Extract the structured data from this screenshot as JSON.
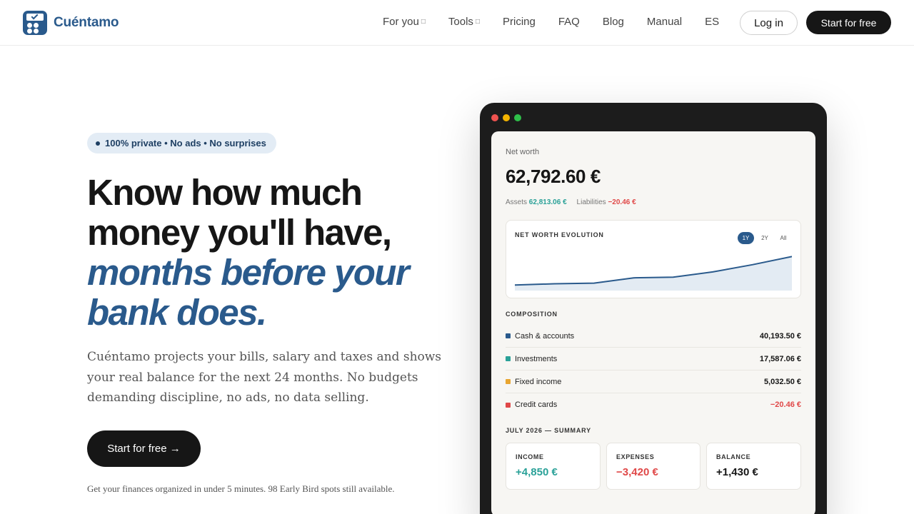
{
  "brand": {
    "name": "Cuéntamo",
    "color": "#2a5a8c"
  },
  "nav": {
    "items": [
      {
        "label": "For you",
        "caret": "□"
      },
      {
        "label": "Tools",
        "caret": "□"
      },
      {
        "label": "Pricing"
      },
      {
        "label": "FAQ"
      },
      {
        "label": "Blog"
      },
      {
        "label": "Manual"
      },
      {
        "label": "ES"
      }
    ],
    "login_label": "Log in",
    "start_label": "Start for free"
  },
  "hero": {
    "badge": "100% private • No ads • No surprises",
    "title_lines": [
      "Know how much",
      "money you'll have,"
    ],
    "title_accent_lines": [
      "months before your",
      "bank does."
    ],
    "subtitle": "Cuéntamo projects your bills, salary and taxes and shows your real balance for the next 24 months. No budgets demanding discipline, no ads, no data selling.",
    "cta_label": "Start for free →",
    "footnote": "Get your finances organized in under 5 minutes. 98 Early Bird spots still available."
  },
  "dashboard": {
    "net_worth_label": "Net worth",
    "net_worth_value": "62,792.60 €",
    "assets_label": "Assets",
    "assets_value": "62,813.06 €",
    "liabilities_label": "Liabilities",
    "liabilities_value": "−20.46 €",
    "evolution_title": "NET WORTH EVOLUTION",
    "ranges": [
      "1Y",
      "2Y",
      "All"
    ],
    "active_range": "1Y",
    "composition_title": "COMPOSITION",
    "composition": [
      {
        "label": "Cash & accounts",
        "value": "40,193.50 €",
        "color": "#2a5a8c"
      },
      {
        "label": "Investments",
        "value": "17,587.06 €",
        "color": "#2aa198"
      },
      {
        "label": "Fixed income",
        "value": "5,032.50 €",
        "color": "#e8a530"
      },
      {
        "label": "Credit cards",
        "value": "−20.46 €",
        "color": "#e04848"
      }
    ],
    "summary_title": "JULY 2026 — SUMMARY",
    "summary": [
      {
        "label": "INCOME",
        "value": "+4,850 €",
        "color": "#2aa198"
      },
      {
        "label": "EXPENSES",
        "value": "−3,420 €",
        "color": "#e04848"
      },
      {
        "label": "BALANCE",
        "value": "+1,430 €",
        "color": "#161616"
      }
    ]
  },
  "chart_data": {
    "type": "area",
    "title": "NET WORTH EVOLUTION",
    "x": [
      1,
      2,
      3,
      4,
      5,
      6,
      7,
      8
    ],
    "series": [
      {
        "values": [
          0.08,
          0.12,
          0.14,
          0.3,
          0.32,
          0.48,
          0.7,
          0.95
        ]
      }
    ],
    "ylim": [
      0,
      1
    ],
    "line_color": "#2a5a8c",
    "fill_color": "#e3ebf3"
  }
}
